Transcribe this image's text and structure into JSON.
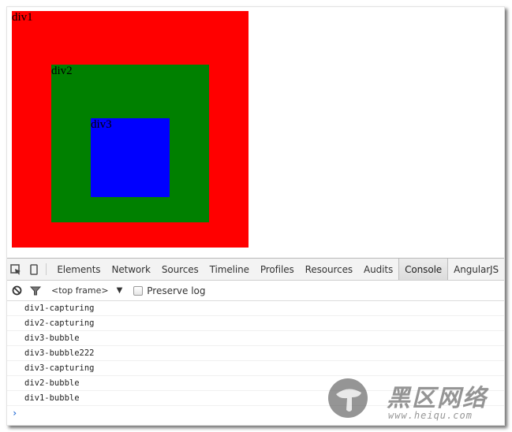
{
  "viewport": {
    "boxes": [
      {
        "id": "div1",
        "label": "div1",
        "color": "#ff0000"
      },
      {
        "id": "div2",
        "label": "div2",
        "color": "#008000"
      },
      {
        "id": "div3",
        "label": "div3",
        "color": "#0000ff"
      }
    ]
  },
  "devtools": {
    "toolbar": {
      "icons": [
        "inspect-element-icon",
        "device-mode-icon"
      ],
      "tabs": [
        {
          "label": "Elements",
          "active": false
        },
        {
          "label": "Network",
          "active": false
        },
        {
          "label": "Sources",
          "active": false
        },
        {
          "label": "Timeline",
          "active": false
        },
        {
          "label": "Profiles",
          "active": false
        },
        {
          "label": "Resources",
          "active": false
        },
        {
          "label": "Audits",
          "active": false
        },
        {
          "label": "Console",
          "active": true
        },
        {
          "label": "AngularJS",
          "active": false
        }
      ]
    },
    "filterbar": {
      "icons": [
        "clear-console-icon",
        "filter-icon"
      ],
      "frame_select": "<top frame>",
      "dropdown_arrow": "▼",
      "preserve_log_label": "Preserve log",
      "preserve_log_checked": false
    },
    "console": {
      "logs": [
        "div1-capturing",
        "div2-capturing",
        "div3-bubble",
        "div3-bubble222",
        "div3-capturing",
        "div2-bubble",
        "div1-bubble"
      ],
      "prompt": "›"
    }
  },
  "watermark": {
    "text": "黑区网络",
    "url": "www.heiqu.com"
  }
}
